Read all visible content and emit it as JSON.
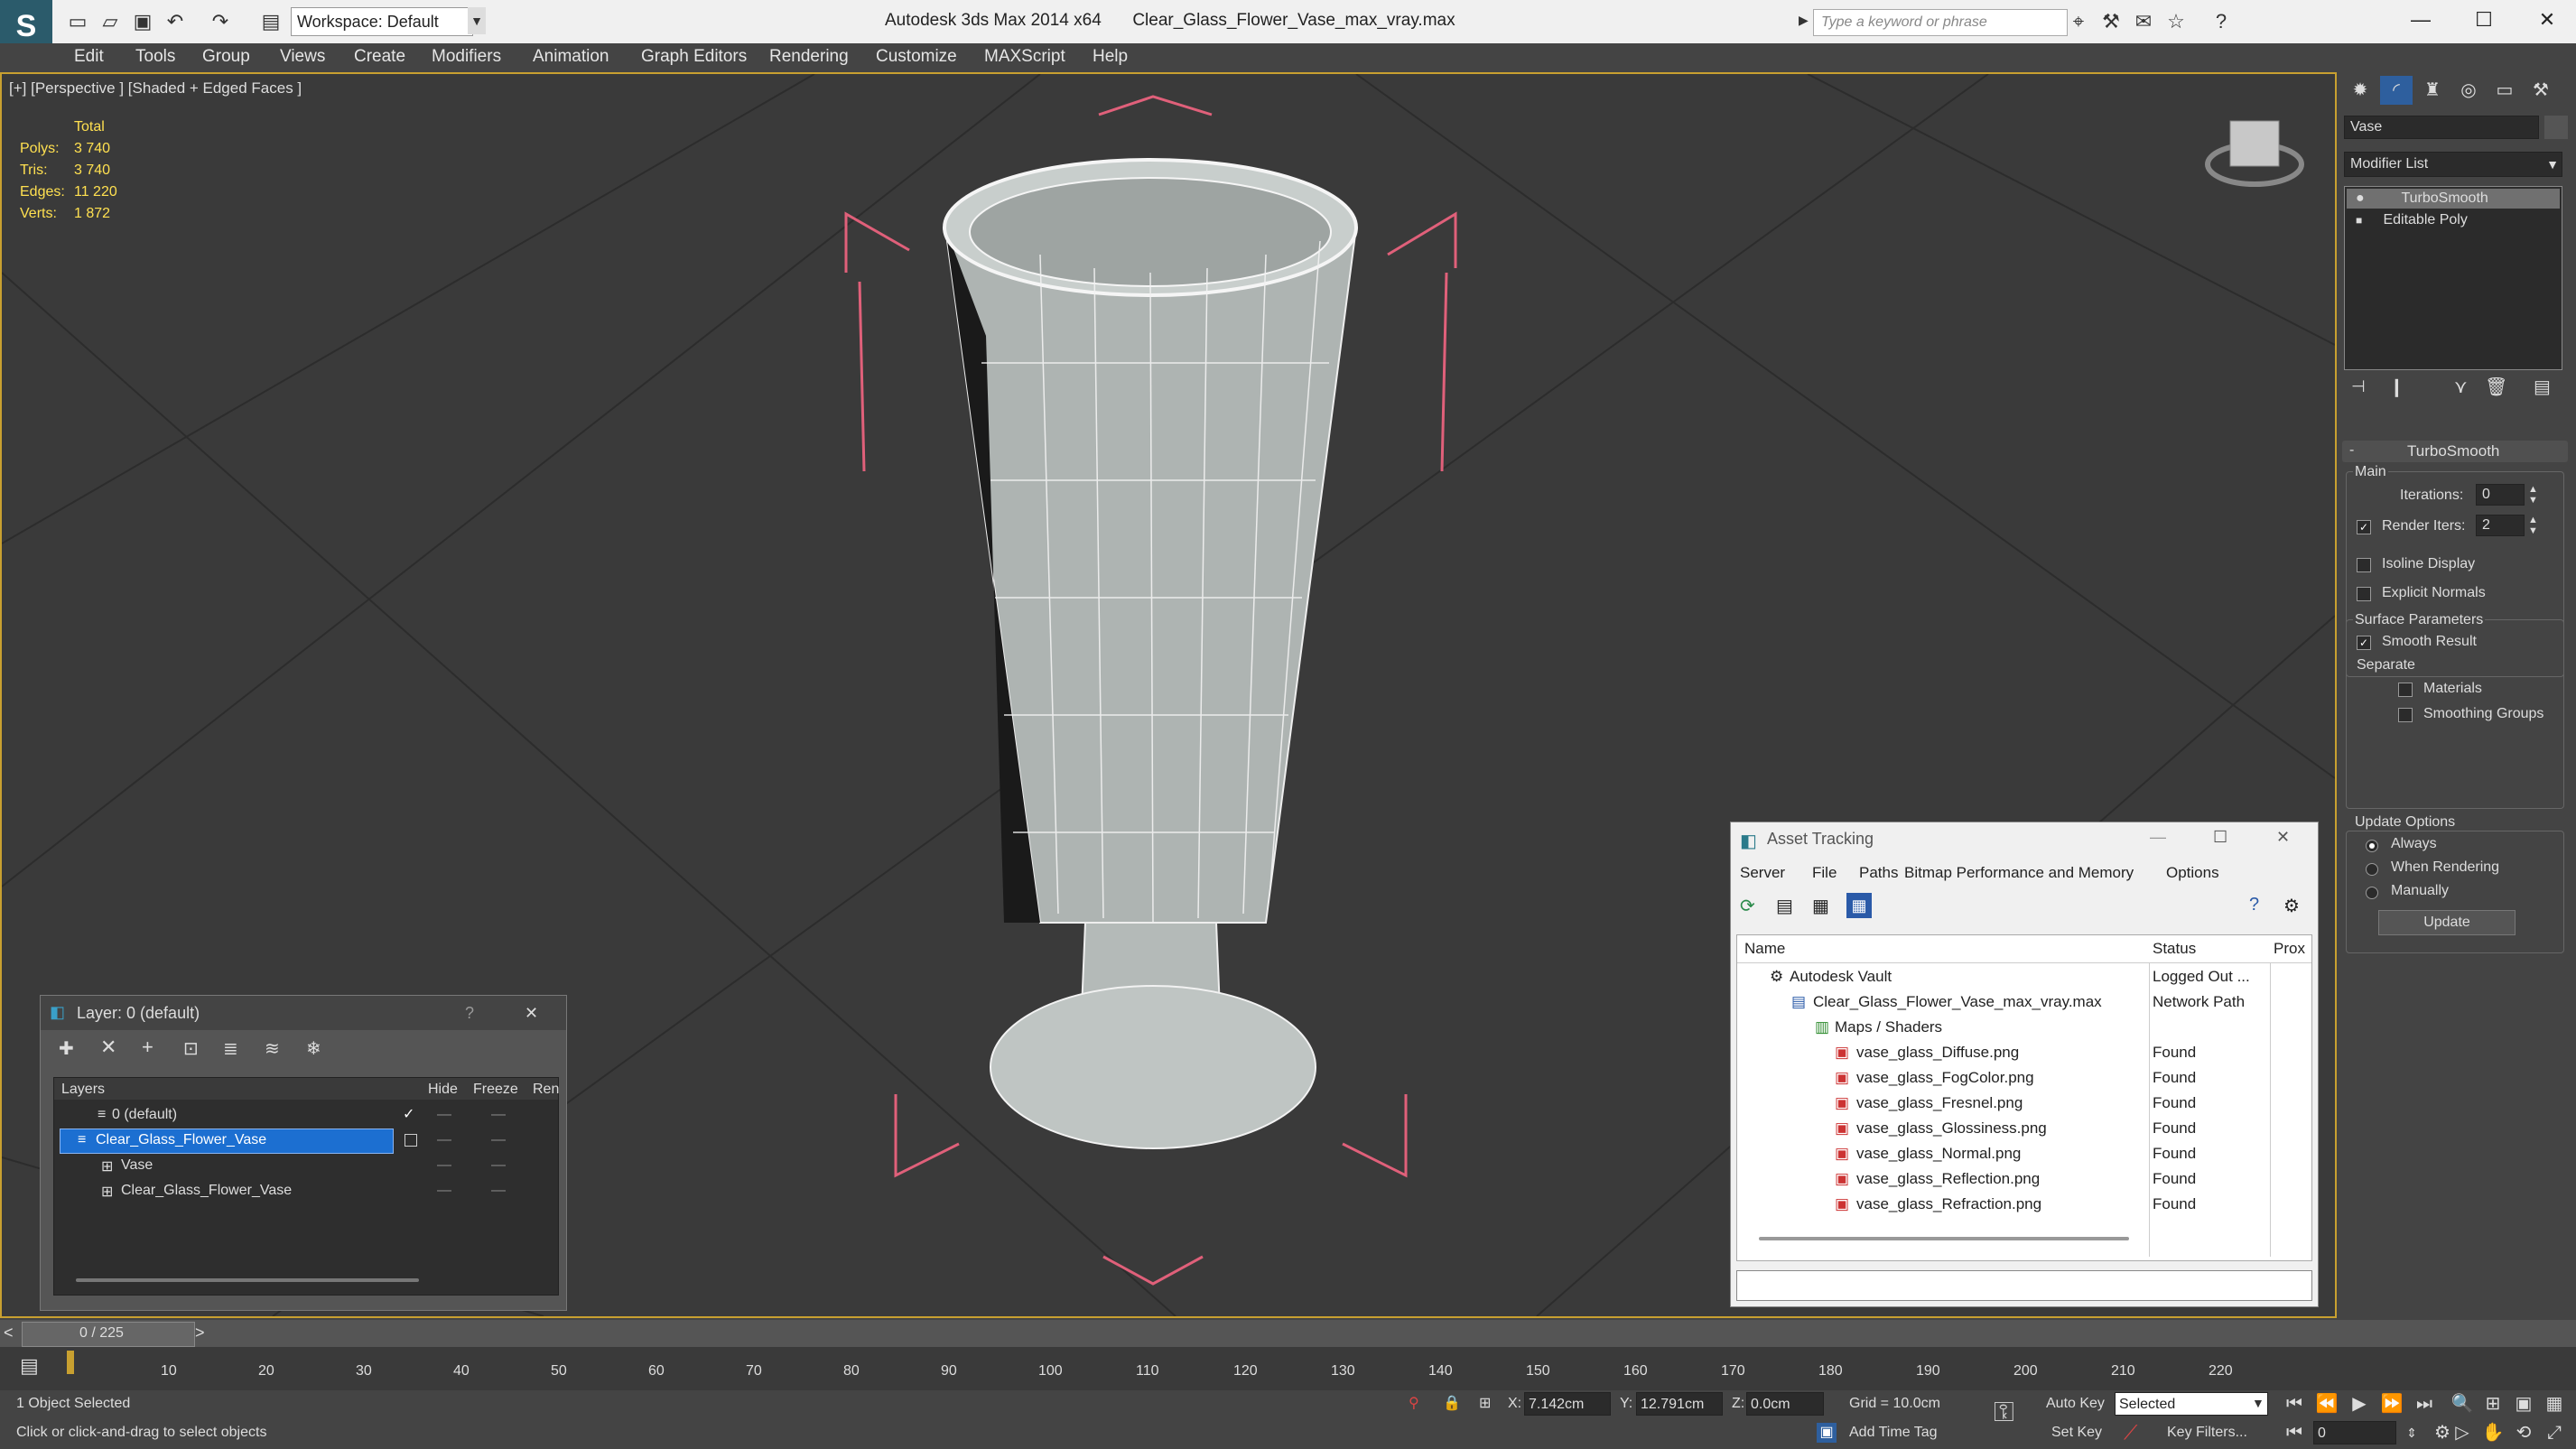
{
  "app": {
    "title": "Autodesk 3ds Max  2014 x64",
    "file": "Clear_Glass_Flower_Vase_max_vray.max",
    "workspace": "Workspace: Default",
    "search_placeholder": "Type a keyword or phrase"
  },
  "menu": [
    "Edit",
    "Tools",
    "Group",
    "Views",
    "Create",
    "Modifiers",
    "Animation",
    "Graph Editors",
    "Rendering",
    "Customize",
    "MAXScript",
    "Help"
  ],
  "viewport": {
    "label": "[+] [Perspective ] [Shaded + Edged Faces ]",
    "stats": {
      "total_label": "Total",
      "rows": [
        {
          "k": "Polys:",
          "v": "3 740"
        },
        {
          "k": "Tris:",
          "v": "3 740"
        },
        {
          "k": "Edges:",
          "v": "11 220"
        },
        {
          "k": "Verts:",
          "v": "1 872"
        }
      ]
    }
  },
  "command_panel": {
    "object_name": "Vase",
    "modifier_list": "Modifier List",
    "stack": [
      "TurboSmooth",
      "Editable Poly"
    ],
    "rollout_title": "TurboSmooth",
    "main_label": "Main",
    "iterations_label": "Iterations:",
    "iterations_value": "0",
    "render_iters_label": "Render Iters:",
    "render_iters_value": "2",
    "isoline": "Isoline Display",
    "explicit": "Explicit Normals",
    "surface_params": "Surface Parameters",
    "smooth_result": "Smooth Result",
    "separate": "Separate",
    "materials": "Materials",
    "smoothing_groups": "Smoothing Groups",
    "update_options": "Update Options",
    "always": "Always",
    "when_rendering": "When Rendering",
    "manually": "Manually",
    "update_button": "Update"
  },
  "layer_window": {
    "title": "Layer: 0 (default)",
    "help": "?",
    "columns": [
      "Layers",
      "Hide",
      "Freeze",
      "Ren"
    ],
    "rows": [
      {
        "name": "0 (default)",
        "indent": 1
      },
      {
        "name": "Clear_Glass_Flower_Vase",
        "indent": 1,
        "selected": true
      },
      {
        "name": "Vase",
        "indent": 2
      },
      {
        "name": "Clear_Glass_Flower_Vase",
        "indent": 2
      }
    ]
  },
  "asset_window": {
    "title": "Asset Tracking",
    "menu": [
      "Server",
      "File",
      "Paths",
      "Bitmap Performance and Memory",
      "Options"
    ],
    "columns": [
      "Name",
      "Status",
      "Prox"
    ],
    "rows": [
      {
        "name": "Autodesk Vault",
        "status": "Logged Out ...",
        "indent": 1
      },
      {
        "name": "Clear_Glass_Flower_Vase_max_vray.max",
        "status": "Network Path",
        "indent": 2
      },
      {
        "name": "Maps / Shaders",
        "status": "",
        "indent": 3
      },
      {
        "name": "vase_glass_Diffuse.png",
        "status": "Found",
        "indent": 4
      },
      {
        "name": "vase_glass_FogColor.png",
        "status": "Found",
        "indent": 4
      },
      {
        "name": "vase_glass_Fresnel.png",
        "status": "Found",
        "indent": 4
      },
      {
        "name": "vase_glass_Glossiness.png",
        "status": "Found",
        "indent": 4
      },
      {
        "name": "vase_glass_Normal.png",
        "status": "Found",
        "indent": 4
      },
      {
        "name": "vase_glass_Reflection.png",
        "status": "Found",
        "indent": 4
      },
      {
        "name": "vase_glass_Refraction.png",
        "status": "Found",
        "indent": 4
      }
    ]
  },
  "timeline": {
    "frame": "0 / 225",
    "ticks": [
      "10",
      "20",
      "30",
      "40",
      "50",
      "60",
      "70",
      "80",
      "90",
      "100",
      "110",
      "120",
      "130",
      "140",
      "150",
      "160",
      "170",
      "180",
      "190",
      "200",
      "210",
      "220"
    ]
  },
  "status": {
    "selected": "1 Object Selected",
    "prompt": "Click or click-and-drag to select objects",
    "x_label": "X:",
    "x_value": "7.142cm",
    "y_label": "Y:",
    "y_value": "12.791cm",
    "z_label": "Z:",
    "z_value": "0.0cm",
    "grid": "Grid = 10.0cm",
    "add_time_tag": "Add Time Tag",
    "auto_key": "Auto Key",
    "selected_dropdown": "Selected",
    "set_key": "Set Key",
    "key_filters": "Key Filters...",
    "current_frame": "0"
  },
  "colors": {
    "viewport_bg": "#3a3a3a",
    "grid_line": "#2a2a2a",
    "selection_bracket": "#e0607a",
    "stat_text": "#ffe050",
    "mesh_fill": "#b0b6b4",
    "mesh_wire": "#f2f2f2",
    "selection_highlight": "#1c6fd1"
  }
}
